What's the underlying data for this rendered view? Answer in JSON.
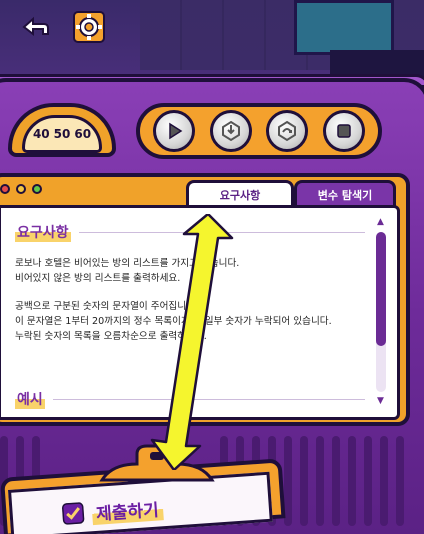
{
  "top_bar": {
    "back_icon": "back-arrow-icon",
    "settings_icon": "gear-icon"
  },
  "dial": {
    "labels": [
      "40",
      "50",
      "60"
    ]
  },
  "controls": [
    {
      "name": "play-button",
      "icon": "play-icon"
    },
    {
      "name": "step-into-button",
      "icon": "step-into-icon"
    },
    {
      "name": "step-over-button",
      "icon": "step-over-icon"
    },
    {
      "name": "stop-button",
      "icon": "stop-icon"
    }
  ],
  "tabs": {
    "requirements": "요구사항",
    "variables": "변수 탐색기"
  },
  "requirements": {
    "title": "요구사항",
    "lines": [
      "로보나 호텔은 비어있는 방의 리스트를 가지고 있습니다.",
      "비어있지 않은 방의 리스트를 출력하세요.",
      "공백으로 구분된 숫자의 문자열이 주어집니다.",
      "이 문자열은 1부터 20까지의 정수 목록이지만, 일부 숫자가 누락되어 있습니다.",
      "누락된 숫자의 목록을 오름차순으로 출력하세요."
    ],
    "example_title": "예시"
  },
  "scroll": {
    "up": "▲",
    "down": "▼"
  },
  "submit": {
    "label": "제출하기"
  },
  "colors": {
    "purple": "#7a2fa3",
    "orange": "#f4a12d",
    "yellow_arrow": "#f5f52e",
    "outline": "#1f0f3a"
  }
}
